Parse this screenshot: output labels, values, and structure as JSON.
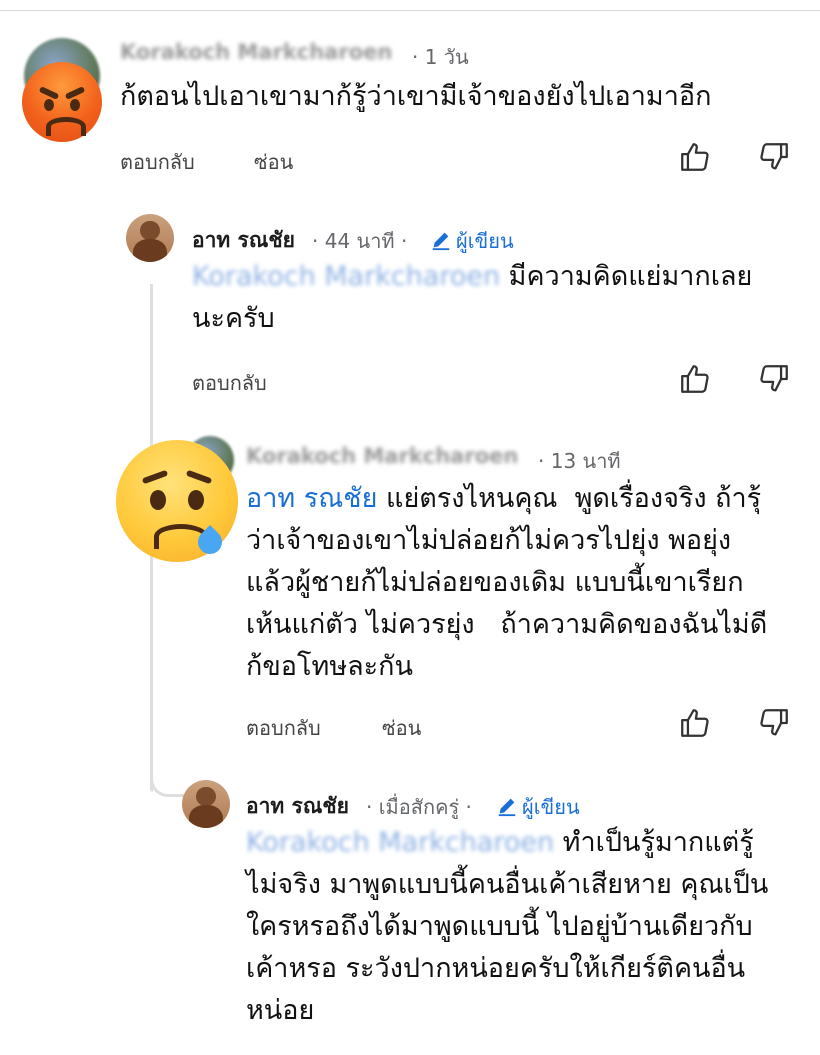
{
  "comments": [
    {
      "author": "Korakoch Markcharoen",
      "time": "· 1 วัน",
      "text": "ก้ตอนไปเอาเขามาก้รู้ว่าเขามีเจ้าของยังไปเอามาอีก",
      "reply_label": "ตอบกลับ",
      "hide_label": "ซ่อน",
      "reaction_icon": "angry-face-emoji"
    },
    {
      "author": "อาท รณชัย",
      "time": "· 44 นาที ·",
      "badge": "ผู้เขียน",
      "mention": "Korakoch Markcharoen",
      "text_line1": " มีความคิดแย่มากเลย",
      "text_line2": "นะครับ",
      "reply_label": "ตอบกลับ"
    },
    {
      "author": "Korakoch Markcharoen",
      "time": "· 13 นาที",
      "mention": "อาท รณชัย",
      "text_line1": " แย่ตรงไหนคุณ  พูดเรื่องจริง ถ้ารุ้",
      "text_rest": "ว่าเจ้าของเขาไม่ปล่อยก้ไม่ควรไปยุ่ง พอยุ่ง\nแล้วผู้ชายก้ไม่ปล่อยของเดิม แบบนี้เขาเรียก\nเห้นแก่ตัว ไม่ควรยุ่ง   ถ้าความคิดของฉันไม่ดี\nก้ขอโทษละกัน",
      "reply_label": "ตอบกลับ",
      "hide_label": "ซ่อน",
      "reaction_icon": "crying-face-emoji"
    },
    {
      "author": "อาท รณชัย",
      "time": "· เมื่อสักครู่ ·",
      "badge": "ผู้เขียน",
      "mention": "Korakoch Markcharoen",
      "text_line1": " ทำเป็นรู้มากแต่รู้",
      "text_rest": "ไม่จริง มาพูดแบบนี้คนอื่นเค้าเสียหาย คุณเป็น\nใครหรอถึงได้มาพูดแบบนี้ ไปอยู่บ้านเดียวกับ\nเค้าหรอ ระวังปากหน่อยครับให้เกียร์ติคนอื่น\nหน่อย"
    }
  ],
  "icons": {
    "like": "thumbs-up-icon",
    "dislike": "thumbs-down-icon",
    "author_badge": "pencil-icon"
  },
  "colors": {
    "link": "#1a6fd6",
    "meta": "#65676b",
    "thread": "#dedede"
  }
}
